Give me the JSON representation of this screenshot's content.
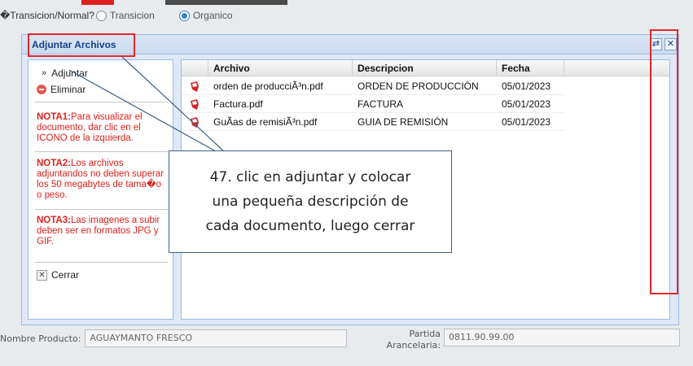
{
  "background": {
    "radio_question": "�Transicion/Normal?",
    "radio_options": [
      {
        "label": "Transicion",
        "checked": false
      },
      {
        "label": "Organico",
        "checked": true
      }
    ],
    "nombre_producto_label": "Nombre Producto:",
    "nombre_producto_value": "AGUAYMANTO FRESCO",
    "partida_label": "Partida Arancelaria:",
    "partida_value": "0811.90.99.00"
  },
  "window": {
    "title": "Adjuntar Archivos",
    "tool_refresh_icon": "refresh-icon",
    "tool_close_icon": "close-icon"
  },
  "actions": {
    "adjuntar": "Adjuntar",
    "eliminar": "Eliminar",
    "cerrar": "Cerrar"
  },
  "notes": [
    {
      "title": "NOTA1:",
      "text": "Para visualizar el documento, dar clic en el ICONO de la izquierda."
    },
    {
      "title": "NOTA2:",
      "text": "Los archivos adjuntandos no deben superar los 50 megabytes de tama�o o peso."
    },
    {
      "title": "NOTA3:",
      "text": "Las imagenes a subir deben ser en formatos JPG y GIF."
    }
  ],
  "table": {
    "columns": [
      "Archivo",
      "Descripcion",
      "Fecha"
    ],
    "rows": [
      {
        "archivo": "orden de producciÃ³n.pdf",
        "descripcion": "ORDEN DE PRODUCCIÓN",
        "fecha": "05/01/2023"
      },
      {
        "archivo": "Factura.pdf",
        "descripcion": "FACTURA",
        "fecha": "05/01/2023"
      },
      {
        "archivo": "GuÃas de remisiÃ³n.pdf",
        "descripcion": "GUIA DE REMISIÓN",
        "fecha": "05/01/2023"
      }
    ]
  },
  "callout": {
    "lines": [
      "47. clic en adjuntar y colocar",
      "una pequeña descripción de",
      "cada documento, luego cerrar"
    ]
  },
  "colors": {
    "header_text": "#15428b",
    "note_red": "#e0201c",
    "highlight_red": "#e8262b",
    "panel_border": "#99bbe8"
  }
}
